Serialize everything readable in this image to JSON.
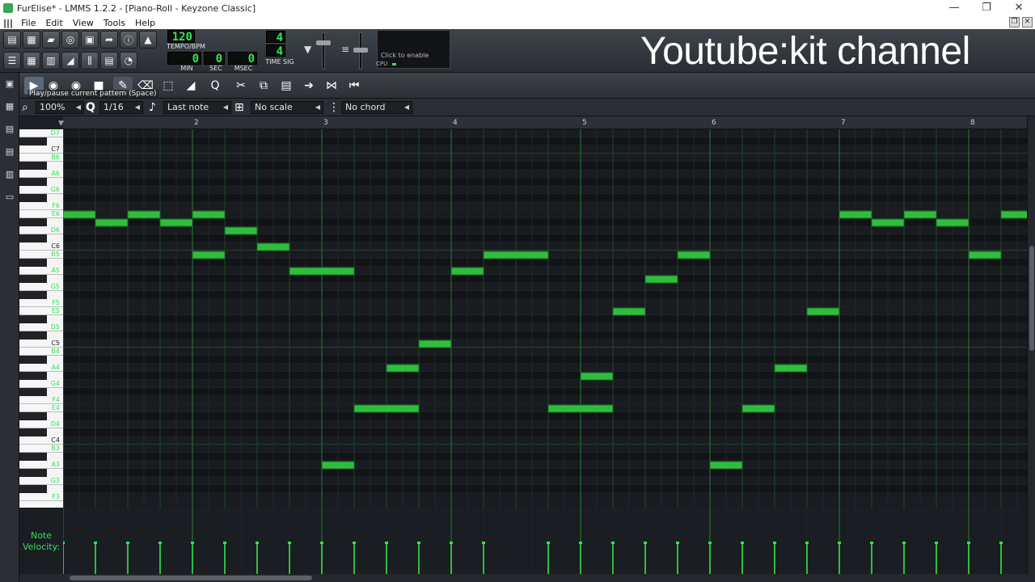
{
  "window": {
    "title": "FurElise* - LMMS 1.2.2 - [Piano-Roll - Keyzone Classic]",
    "controls": [
      "—",
      "❐",
      "✕"
    ]
  },
  "menu": [
    "File",
    "Edit",
    "View",
    "Tools",
    "Help"
  ],
  "transport": {
    "tempo": "120",
    "tempo_label": "TEMPO/BPM",
    "time_min": "0",
    "time_sec": "0",
    "time_msec": "0",
    "min_label": "MIN",
    "sec_label": "SEC",
    "msec_label": "MSEC",
    "timesig_num": "4",
    "timesig_den": "4",
    "timesig_label": "TIME SIG",
    "cpu_hint": "Click to enable",
    "cpu_label": "CPU"
  },
  "watermark": "Youtube:kit channel",
  "tooltip": "Play/pause current pattern (Space)",
  "options": {
    "zoom": "100%",
    "quantize": "1/16",
    "note_length": "Last note",
    "scale": "No scale",
    "chord": "No chord"
  },
  "timeline": {
    "bars": [
      "2",
      "3",
      "4",
      "5",
      "6",
      "7",
      "8"
    ]
  },
  "piano_labels": [
    "D7",
    "C7",
    "B6",
    "A6",
    "G6",
    "F6",
    "E6",
    "D6",
    "C6",
    "B5",
    "A5",
    "G5",
    "F5",
    "E5",
    "D5",
    "C5",
    "B4",
    "A4",
    "G4",
    "F4",
    "E4",
    "D4",
    "C4",
    "B3",
    "A3",
    "G3",
    "F3"
  ],
  "velocity_label_1": "Note",
  "velocity_label_2": "Velocity:",
  "colors": {
    "note": "#2fbd3e",
    "grid_bg": "#141619",
    "accent": "#37e05a"
  },
  "notes": [
    {
      "pitch": "E6",
      "start": 0,
      "len": 1
    },
    {
      "pitch": "D#6",
      "start": 1,
      "len": 1
    },
    {
      "pitch": "E6",
      "start": 2,
      "len": 1
    },
    {
      "pitch": "D#6",
      "start": 3,
      "len": 1
    },
    {
      "pitch": "E6",
      "start": 4,
      "len": 1
    },
    {
      "pitch": "B5",
      "start": 4,
      "len": 1
    },
    {
      "pitch": "D6",
      "start": 5,
      "len": 1
    },
    {
      "pitch": "C6",
      "start": 6,
      "len": 1
    },
    {
      "pitch": "A5",
      "start": 7,
      "len": 2
    },
    {
      "pitch": "A3",
      "start": 8,
      "len": 1
    },
    {
      "pitch": "E4",
      "start": 9,
      "len": 2
    },
    {
      "pitch": "A4",
      "start": 10,
      "len": 1
    },
    {
      "pitch": "C5",
      "start": 11,
      "len": 1
    },
    {
      "pitch": "A5",
      "start": 12,
      "len": 1
    },
    {
      "pitch": "B5",
      "start": 13,
      "len": 2
    },
    {
      "pitch": "E4",
      "start": 15,
      "len": 2
    },
    {
      "pitch": "G#4",
      "start": 16,
      "len": 1
    },
    {
      "pitch": "E5",
      "start": 17,
      "len": 1
    },
    {
      "pitch": "G#5",
      "start": 18,
      "len": 1
    },
    {
      "pitch": "B5",
      "start": 19,
      "len": 1
    },
    {
      "pitch": "A3",
      "start": 20,
      "len": 1
    },
    {
      "pitch": "E4",
      "start": 21,
      "len": 1
    },
    {
      "pitch": "A4",
      "start": 22,
      "len": 1
    },
    {
      "pitch": "E5",
      "start": 23,
      "len": 1
    },
    {
      "pitch": "E6",
      "start": 24,
      "len": 1
    },
    {
      "pitch": "D#6",
      "start": 25,
      "len": 1
    },
    {
      "pitch": "E6",
      "start": 26,
      "len": 1
    },
    {
      "pitch": "D#6",
      "start": 27,
      "len": 1
    },
    {
      "pitch": "E6",
      "start": 29,
      "len": 1
    },
    {
      "pitch": "B5",
      "start": 28,
      "len": 1
    }
  ]
}
